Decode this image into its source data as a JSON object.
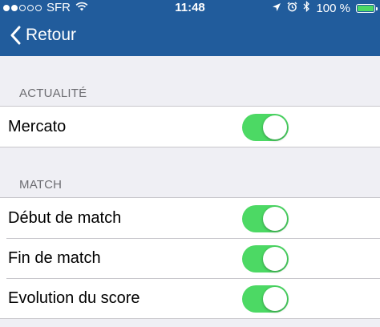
{
  "status_bar": {
    "carrier": "SFR",
    "time": "11:48",
    "battery_percent": "100 %",
    "signal_dots_filled": 2,
    "signal_dots_total": 5,
    "icons": [
      "wifi-icon",
      "location-arrow-icon",
      "alarm-icon",
      "bluetooth-icon",
      "battery-icon"
    ],
    "battery_color": "#4cd964"
  },
  "nav": {
    "back_label": "Retour",
    "bar_color": "#215c9c"
  },
  "sections": [
    {
      "header": "ACTUALITÉ",
      "rows": [
        {
          "label": "Mercato",
          "enabled": true
        }
      ]
    },
    {
      "header": "MATCH",
      "rows": [
        {
          "label": "Début de match",
          "enabled": true
        },
        {
          "label": "Fin de match",
          "enabled": true
        },
        {
          "label": "Evolution du score",
          "enabled": true
        }
      ]
    }
  ],
  "colors": {
    "toggle_on": "#4cd964",
    "background": "#efeff4",
    "section_header_text": "#6d6d72"
  }
}
